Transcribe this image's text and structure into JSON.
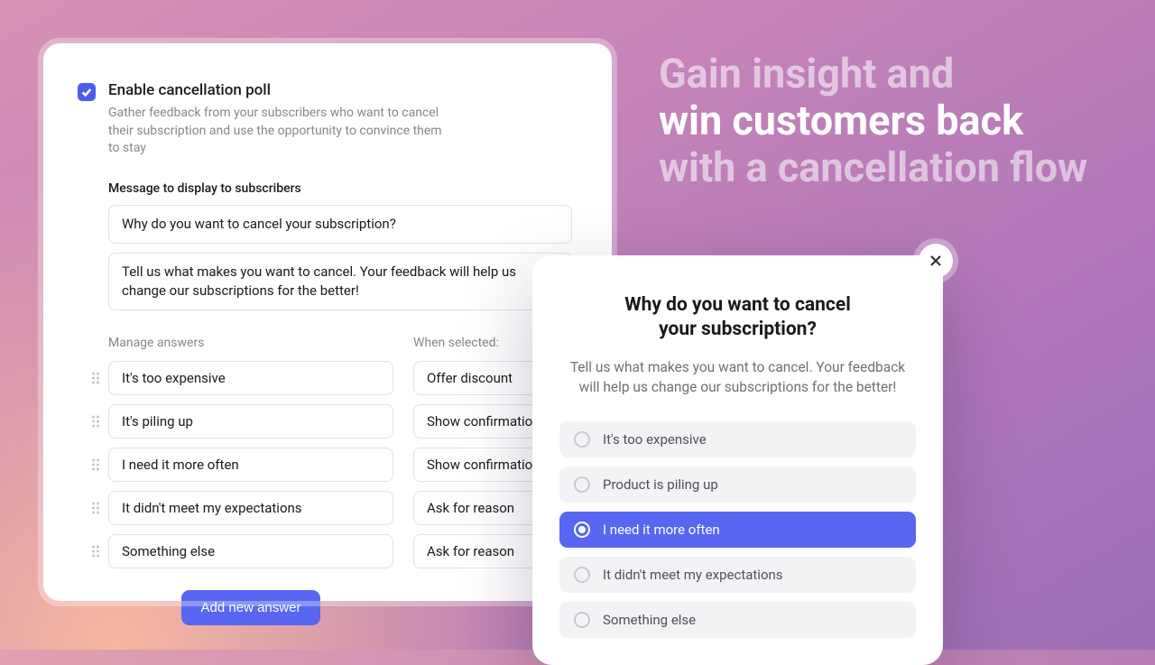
{
  "settings": {
    "enable_label": "Enable cancellation poll",
    "enable_helper": "Gather feedback from your subscribers who want to cancel their subscription and use the opportunity to convince them to stay",
    "message_section_label": "Message to display to subscribers",
    "question_value": "Why do you want to cancel your subscription?",
    "description_value": "Tell us what makes you want to cancel. Your feedback will help us change our  subscriptions for the better!",
    "manage_answers_label": "Manage answers",
    "when_selected_label": "When selected:",
    "answers": [
      {
        "text": "It's too expensive",
        "action": "Offer discount"
      },
      {
        "text": "It's piling up",
        "action": "Show confirmation"
      },
      {
        "text": "I need it more often",
        "action": "Show confirmation"
      },
      {
        "text": "It didn't meet my expectations",
        "action": "Ask for reason"
      },
      {
        "text": "Something else",
        "action": "Ask for reason"
      }
    ],
    "add_answer_label": "Add new answer"
  },
  "hero": {
    "line1": "Gain insight and",
    "line2": "win customers back",
    "line3": "with a cancellation flow"
  },
  "preview": {
    "title_line1": "Why do you want to cancel",
    "title_line2": "your subscription?",
    "subtitle": "Tell us what makes you want to cancel. Your feedback will help us change our subscriptions for the better!",
    "options": [
      {
        "label": "It's too expensive",
        "selected": false
      },
      {
        "label": "Product is piling up",
        "selected": false
      },
      {
        "label": "I need it more often",
        "selected": true
      },
      {
        "label": "It didn't meet my expectations",
        "selected": false
      },
      {
        "label": "Something else",
        "selected": false
      }
    ]
  },
  "colors": {
    "accent": "#5866f2"
  }
}
